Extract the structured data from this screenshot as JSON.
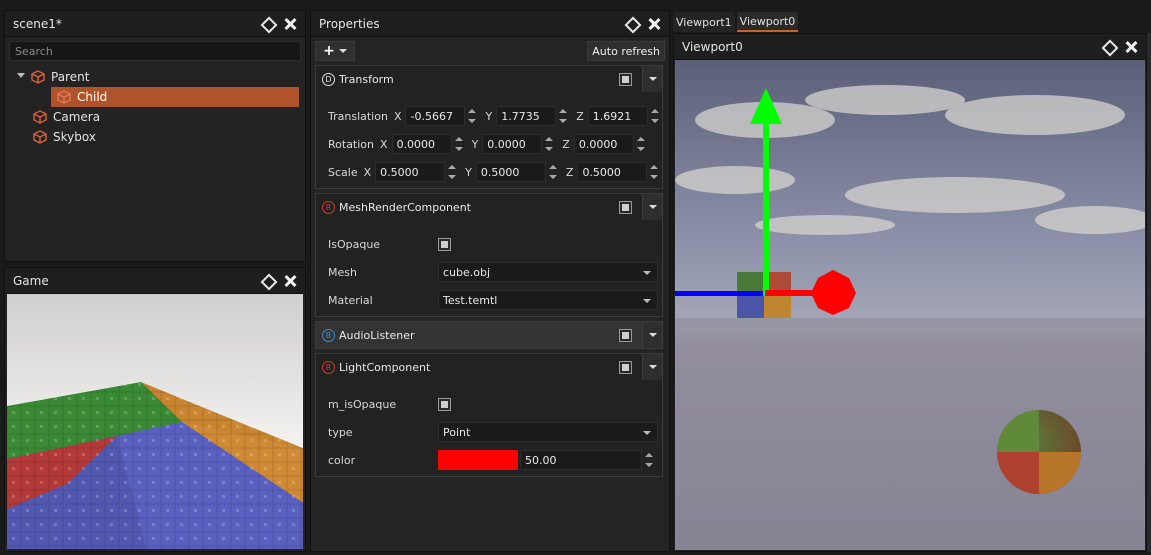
{
  "scene_panel": {
    "title": "scene1*",
    "search_placeholder": "Search",
    "tree": [
      {
        "label": "Parent",
        "icon": "cube-icon",
        "expanded": true
      },
      {
        "label": "Child",
        "icon": "cube-icon",
        "selected": true
      },
      {
        "label": "Camera",
        "icon": "cube-icon"
      },
      {
        "label": "Skybox",
        "icon": "cube-icon"
      }
    ]
  },
  "game_panel": {
    "title": "Game"
  },
  "properties": {
    "title": "Properties",
    "add_label": "+",
    "auto_refresh_label": "Auto refresh",
    "transform": {
      "name": "Transform",
      "badge": "D",
      "translation": {
        "label": "Translation",
        "x": "-0.5667",
        "y": "1.7735",
        "z": "1.6921"
      },
      "rotation": {
        "label": "Rotation",
        "x": "0.0000",
        "y": "0.0000",
        "z": "0.0000"
      },
      "scale": {
        "label": "Scale",
        "x": "0.5000",
        "y": "0.5000",
        "z": "0.5000"
      },
      "axis_x": "X",
      "axis_y": "Y",
      "axis_z": "Z"
    },
    "mesh_render": {
      "name": "MeshRenderComponent",
      "badge": "R",
      "is_opaque_label": "IsOpaque",
      "mesh_label": "Mesh",
      "mesh_value": "cube.obj",
      "material_label": "Material",
      "material_value": "Test.temtl"
    },
    "audio_listener": {
      "name": "AudioListener",
      "badge": "B"
    },
    "light": {
      "name": "LightComponent",
      "badge": "R",
      "opaque_label": "m_isOpaque",
      "type_label": "type",
      "type_value": "Point",
      "color_label": "color",
      "color_hex": "#ff0000",
      "color_value": "50.00"
    }
  },
  "viewport": {
    "tabs": [
      {
        "label": "Viewport1",
        "active": false
      },
      {
        "label": "Viewport0",
        "active": true
      }
    ],
    "title": "Viewport0"
  },
  "colors": {
    "accent": "#b0532b",
    "gizmo_x": "#ff0000",
    "gizmo_y": "#00ff00",
    "gizmo_z": "#0000ff"
  }
}
